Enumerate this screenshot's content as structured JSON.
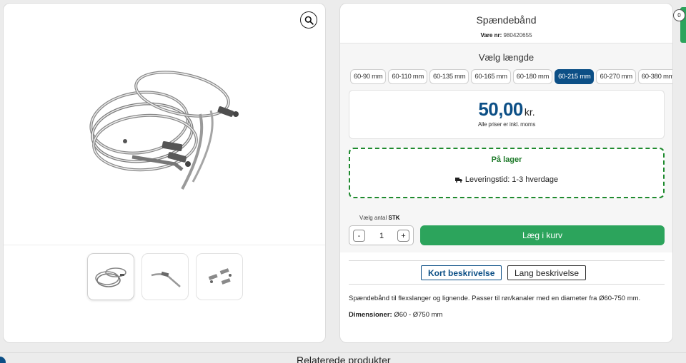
{
  "product": {
    "title": "Spændebånd",
    "sku_label": "Vare nr:",
    "sku_value": "980420655"
  },
  "length": {
    "heading": "Vælg længde",
    "options": [
      "60-90 mm",
      "60-110 mm",
      "60-135 mm",
      "60-165 mm",
      "60-180 mm",
      "60-215 mm",
      "60-270 mm",
      "60-380 mm"
    ],
    "selected": "60-215 mm"
  },
  "price": {
    "amount": "50,00",
    "currency": "kr.",
    "note": "Alle priser er inkl. moms"
  },
  "stock": {
    "status": "På lager",
    "delivery": "Leveringstid: 1-3 hverdage"
  },
  "quantity": {
    "label": "Vælg antal",
    "unit": "STK",
    "value": "1",
    "minus": "-",
    "plus": "+"
  },
  "cart_button": "Læg i kurv",
  "description": {
    "tabs": [
      "Kort beskrivelse",
      "Lang beskrivelse"
    ],
    "active_tab": "Kort beskrivelse",
    "text": "Spændebånd til flexslanger og lignende. Passer til rør/kanaler med en diameter fra Ø60-750 mm.",
    "dimensions_label": "Dimensioner:",
    "dimensions_value": "Ø60 - Ø750 mm"
  },
  "cart_badge": "0",
  "related_heading": "Relaterede produkter",
  "icons": {
    "zoom": "magnifier-icon",
    "delivery": "truck-icon"
  },
  "colors": {
    "brand_blue": "#0c4f86",
    "accent_green": "#2ca45c",
    "stock_green": "#1e8a2e"
  }
}
